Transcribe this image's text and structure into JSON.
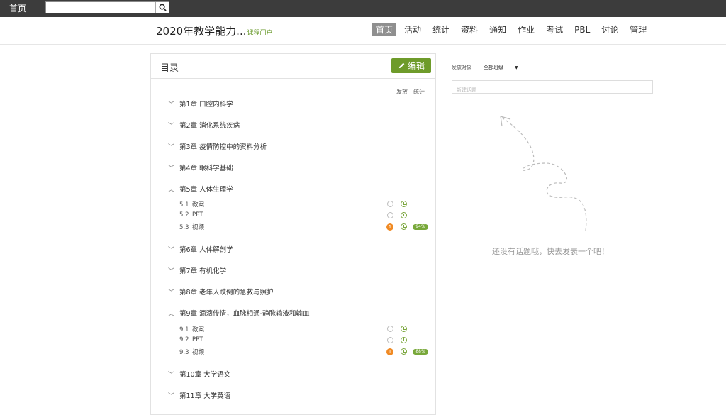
{
  "topbar": {
    "home_label": "首页",
    "search_value": ""
  },
  "course": {
    "title": "2020年教学能力...",
    "portal_link": "课程门户"
  },
  "nav": [
    "首页",
    "活动",
    "统计",
    "资料",
    "通知",
    "作业",
    "考试",
    "PBL",
    "讨论",
    "管理"
  ],
  "nav_active": "首页",
  "catalog": {
    "title": "目录",
    "edit_label": "编辑",
    "col_publish": "发放",
    "col_stats": "统计",
    "chapters": [
      "第1章 口腔内科学",
      "第2章 消化系统疾病",
      "第3章 疫情防控中的资料分析",
      "第4章 眼科学基础",
      "第5章 人体生理学",
      "第6章 人体解剖学",
      "第7章 有机化学",
      "第8章 老年人跌倒的急救与照护",
      "第9章 滴滴传情，血脉相通-静脉输液和输血",
      "第10章 大学语文",
      "第11章 大学英语"
    ],
    "ch5_sections": [
      {
        "num": "5.1",
        "name": "教案",
        "badge": "",
        "progress": ""
      },
      {
        "num": "5.2",
        "name": "PPT",
        "badge": "",
        "progress": ""
      },
      {
        "num": "5.3",
        "name": "视频",
        "badge": "1",
        "progress": "94%"
      }
    ],
    "ch9_sections": [
      {
        "num": "9.1",
        "name": "教案",
        "badge": "",
        "progress": ""
      },
      {
        "num": "9.2",
        "name": "PPT",
        "badge": "",
        "progress": ""
      },
      {
        "num": "9.3",
        "name": "视频",
        "badge": "1",
        "progress": "88%"
      }
    ]
  },
  "discussion": {
    "target_label": "发放对象",
    "target_value": "全部班级",
    "topic_placeholder": "新建话题",
    "empty_message": "还没有话题哦，快去发表一个吧！"
  },
  "colors": {
    "topbar_bg": "#3c3c3c",
    "accent_green": "#6e9b2a",
    "badge_orange": "#f08a24",
    "nav_active_bg": "#8f8f8f"
  }
}
